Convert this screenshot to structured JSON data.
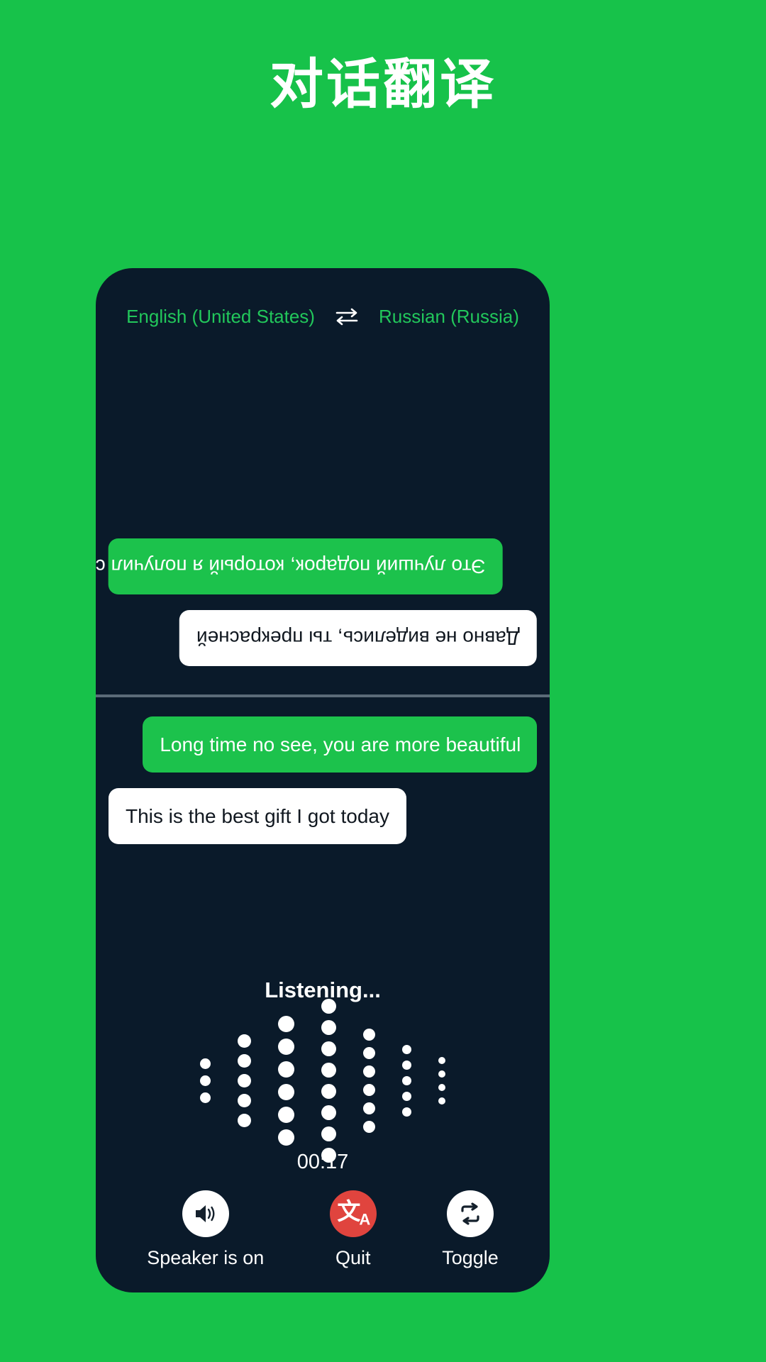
{
  "page": {
    "title": "对话翻译",
    "background_color": "#17c24a"
  },
  "device": {
    "background_color": "#0a1a2a"
  },
  "language_bar": {
    "source_language": "English (United States)",
    "target_language": "Russian (Russia)",
    "swap_icon": "swap-horizontal-icon",
    "text_color": "#22c75b"
  },
  "conversation": {
    "top_pane": {
      "orientation": "flipped-180",
      "messages": [
        {
          "text": "Это лучший подарок, который я получил сегодня",
          "style": "green",
          "align": "left"
        },
        {
          "text": "Давно не виделись, ты прекрасней",
          "style": "white",
          "align": "right"
        }
      ]
    },
    "bottom_pane": {
      "orientation": "normal",
      "messages": [
        {
          "text": "Long time no see, you are more beautiful",
          "style": "green",
          "align": "right"
        },
        {
          "text": "This is the best gift I got today",
          "style": "white",
          "align": "left"
        }
      ]
    },
    "bubble_green_color": "#1cc24c",
    "bubble_white_color": "#ffffff"
  },
  "status": {
    "listening_label": "Listening...",
    "timer": "00:17"
  },
  "waveform": {
    "columns": [
      {
        "dot_size": 15,
        "count": 3
      },
      {
        "dot_size": 19,
        "count": 5
      },
      {
        "dot_size": 23,
        "count": 6
      },
      {
        "dot_size": 21,
        "count": 8
      },
      {
        "dot_size": 17,
        "count": 6
      },
      {
        "dot_size": 13,
        "count": 5
      },
      {
        "dot_size": 10,
        "count": 4
      }
    ],
    "dot_color": "#ffffff"
  },
  "controls": [
    {
      "label": "Speaker is on",
      "icon": "speaker-on-icon",
      "circle_color": "#ffffff"
    },
    {
      "label": "Quit",
      "icon": "translate-icon",
      "circle_color": "#e0443e"
    },
    {
      "label": "Toggle",
      "icon": "swap-repeat-icon",
      "circle_color": "#ffffff"
    }
  ]
}
